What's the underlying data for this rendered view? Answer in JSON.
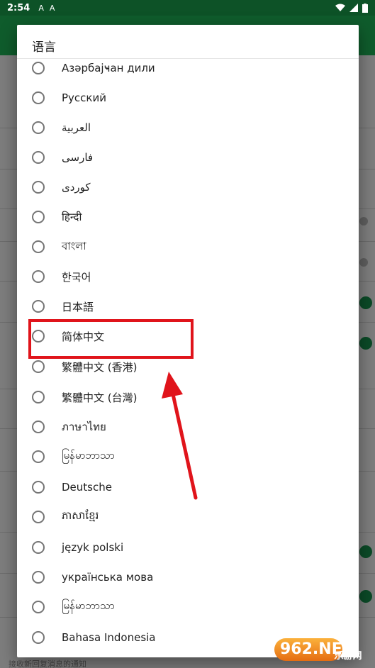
{
  "status_bar": {
    "time": "2:54",
    "notif_icons": [
      "A",
      "A"
    ]
  },
  "dialog": {
    "title": "语言",
    "options": [
      {
        "label": "Азәрбајҹан дили"
      },
      {
        "label": "Русский"
      },
      {
        "label": "العربية"
      },
      {
        "label": "فارسی"
      },
      {
        "label": "کوردی"
      },
      {
        "label": "हिन्दी"
      },
      {
        "label": "বাংলা"
      },
      {
        "label": "한국어"
      },
      {
        "label": "日本語"
      },
      {
        "label": "简体中文"
      },
      {
        "label": "繁體中文 (香港)"
      },
      {
        "label": "繁體中文 (台灣)"
      },
      {
        "label": "ภาษาไทย"
      },
      {
        "label": "မြန်မာဘာသာ"
      },
      {
        "label": "Deutsche"
      },
      {
        "label": "ភាសាខ្មែរ"
      },
      {
        "label": "język polski"
      },
      {
        "label": "українська мова"
      },
      {
        "label": "မြန်မာဘာသာ"
      },
      {
        "label": "Bahasa Indonesia"
      }
    ]
  },
  "background": {
    "bottom_text": "接收新回复消息的通知"
  },
  "watermark": {
    "brand": "962.NET",
    "sub": "乐游网"
  },
  "colors": {
    "status_bar": "#0d5227",
    "toggle_on": "#0b4a27",
    "highlight": "#e0141b"
  }
}
